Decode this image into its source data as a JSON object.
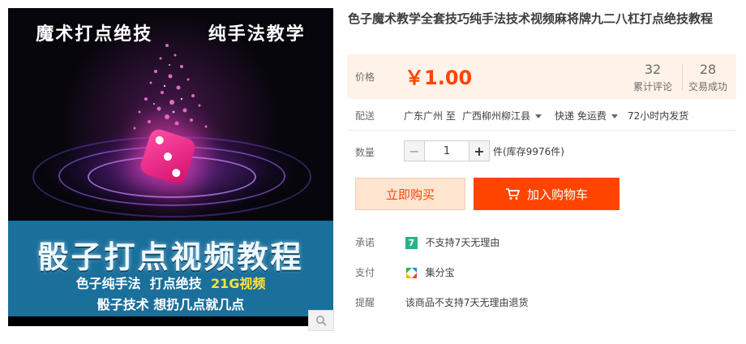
{
  "image": {
    "top_left_text": "魔术打点绝技",
    "top_right_text": "纯手法教学",
    "band_title": "骰子打点视频教程",
    "band_line2_a": "色子纯手法",
    "band_line2_b": "打点绝技",
    "band_line2_c": "21G视频",
    "band_line3": "骰子技术  想扔几点就几点",
    "zoom_icon": "magnifier-icon"
  },
  "product": {
    "title": "色子魔术教学全套技巧纯手法技术视频麻将牌九二八杠打点绝技教程"
  },
  "price": {
    "label": "价格",
    "value": "￥1.00",
    "reviews_count": "32",
    "reviews_label": "累计评论",
    "sales_count": "28",
    "sales_label": "交易成功"
  },
  "delivery": {
    "label": "配送",
    "from": "广东广州 至",
    "to": "广西柳州柳江县",
    "shipping": "快递 免运费",
    "dispatch": "72小时内发货"
  },
  "quantity": {
    "label": "数量",
    "minus": "−",
    "value": "1",
    "plus": "+",
    "stock": "件(库存9976件)"
  },
  "actions": {
    "buy_now": "立即购买",
    "add_to_cart": "加入购物车"
  },
  "promise": {
    "label": "承诺",
    "badge": "7",
    "text": "不支持7天无理由"
  },
  "payment": {
    "label": "支付",
    "text": "集分宝"
  },
  "reminder": {
    "label": "提醒",
    "text": "该商品不支持7天无理由退货"
  },
  "colors": {
    "accent": "#ff4400",
    "price_bg": "#fff2e8",
    "band": "#1a6f9b"
  }
}
